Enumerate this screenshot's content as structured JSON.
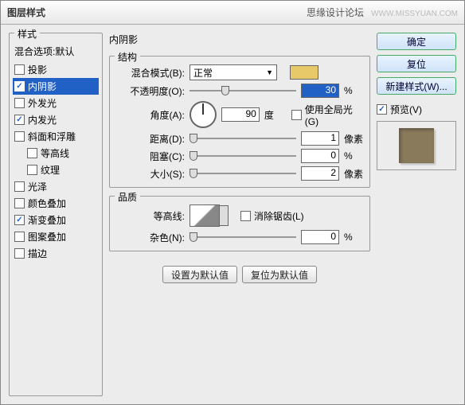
{
  "titlebar": {
    "title": "图层样式",
    "forum": "思缘设计论坛",
    "watermark": "WWW.MISSYUAN.COM"
  },
  "left": {
    "group_title": "样式",
    "blend_options": "混合选项:默认",
    "items": [
      {
        "label": "投影",
        "checked": false,
        "selected": false
      },
      {
        "label": "内阴影",
        "checked": true,
        "selected": true
      },
      {
        "label": "外发光",
        "checked": false,
        "selected": false
      },
      {
        "label": "内发光",
        "checked": true,
        "selected": false
      },
      {
        "label": "斜面和浮雕",
        "checked": false,
        "selected": false
      },
      {
        "label": "等高线",
        "checked": false,
        "selected": false,
        "sub": true
      },
      {
        "label": "纹理",
        "checked": false,
        "selected": false,
        "sub": true
      },
      {
        "label": "光泽",
        "checked": false,
        "selected": false
      },
      {
        "label": "颜色叠加",
        "checked": false,
        "selected": false
      },
      {
        "label": "渐变叠加",
        "checked": true,
        "selected": false
      },
      {
        "label": "图案叠加",
        "checked": false,
        "selected": false
      },
      {
        "label": "描边",
        "checked": false,
        "selected": false
      }
    ]
  },
  "center": {
    "title": "内阴影",
    "structure": {
      "group_title": "结构",
      "blend_mode_label": "混合模式(B):",
      "blend_mode_value": "正常",
      "color": "#e8c96a",
      "opacity_label": "不透明度(O):",
      "opacity_value": "30",
      "opacity_unit": "%",
      "angle_label": "角度(A):",
      "angle_value": "90",
      "angle_unit": "度",
      "global_light_label": "使用全局光(G)",
      "global_light_checked": false,
      "distance_label": "距离(D):",
      "distance_value": "1",
      "distance_unit": "像素",
      "choke_label": "阻塞(C):",
      "choke_value": "0",
      "choke_unit": "%",
      "size_label": "大小(S):",
      "size_value": "2",
      "size_unit": "像素"
    },
    "quality": {
      "group_title": "品质",
      "contour_label": "等高线:",
      "antialias_label": "消除锯齿(L)",
      "antialias_checked": false,
      "noise_label": "杂色(N):",
      "noise_value": "0",
      "noise_unit": "%"
    },
    "buttons": {
      "set_default": "设置为默认值",
      "reset_default": "复位为默认值"
    }
  },
  "right": {
    "ok": "确定",
    "cancel": "复位",
    "new_style": "新建样式(W)...",
    "preview_label": "预览(V)",
    "preview_checked": true
  }
}
